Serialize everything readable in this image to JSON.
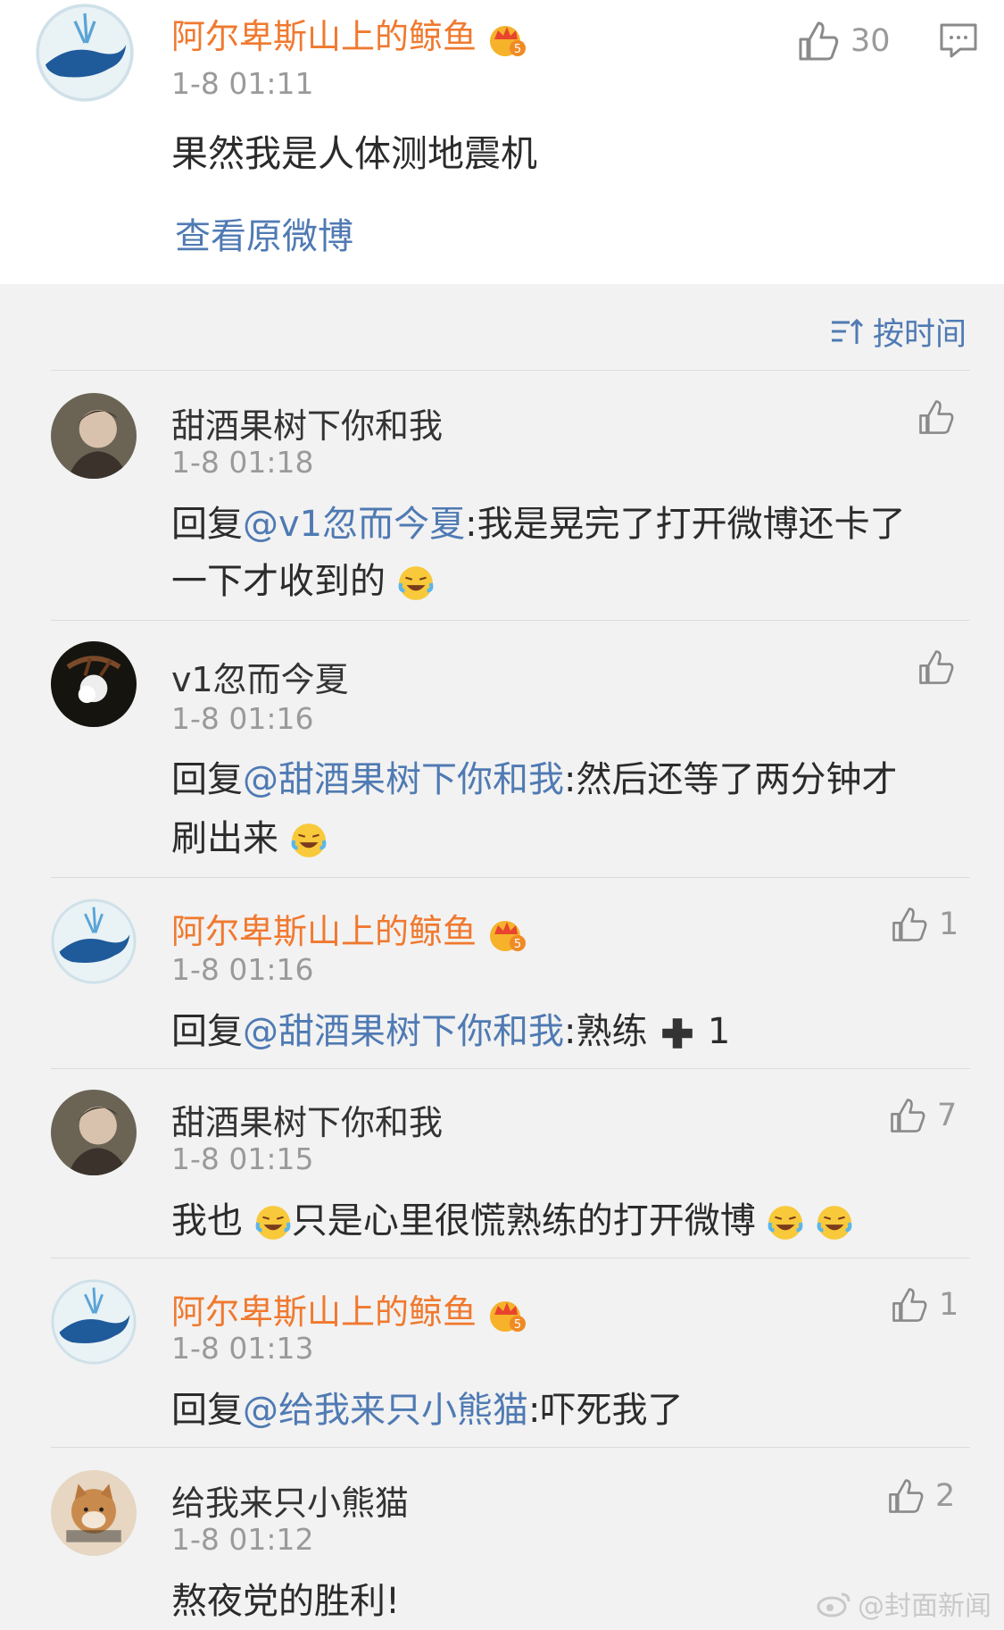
{
  "post": {
    "author": "阿尔卑斯山上的鲸鱼",
    "time": "1-8 01:11",
    "likes": "30",
    "text": "果然我是人体测地震机",
    "view_original": "查看原微博"
  },
  "sort": {
    "label": "按时间"
  },
  "comments": [
    {
      "author": "甜酒果树下你和我",
      "time": "1-8 01:18",
      "likes": "",
      "line1_prefix": "回复",
      "line1_mention": "@v1忽而今夏",
      "line1_rest": ":我是晃完了打开微博还卡了",
      "line2": "一下才收到的"
    },
    {
      "author": "v1忽而今夏",
      "time": "1-8 01:16",
      "likes": "",
      "line1_prefix": "回复",
      "line1_mention": "@甜酒果树下你和我",
      "line1_rest": ":然后还等了两分钟才",
      "line2": "刷出来"
    },
    {
      "author": "阿尔卑斯山上的鲸鱼",
      "time": "1-8 01:16",
      "likes": "1",
      "line1_prefix": "回复",
      "line1_mention": "@甜酒果树下你和我",
      "line1_rest": ":熟练",
      "line1_suffix": " 1"
    },
    {
      "author": "甜酒果树下你和我",
      "time": "1-8 01:15",
      "likes": "7",
      "line1_a": "我也",
      "line1_b": "只是心里很慌熟练的打开微博"
    },
    {
      "author": "阿尔卑斯山上的鲸鱼",
      "time": "1-8 01:13",
      "likes": "1",
      "line1_prefix": "回复",
      "line1_mention": "@给我来只小熊猫",
      "line1_rest": ":吓死我了"
    },
    {
      "author": "给我来只小熊猫",
      "time": "1-8 01:12",
      "likes": "2",
      "line1": "熬夜党的胜利!"
    }
  ],
  "watermark": "@封面新闻",
  "colors": {
    "orange_name": "#f0792f",
    "link_blue": "#4f7ab3",
    "gray": "#9a9a9a"
  }
}
